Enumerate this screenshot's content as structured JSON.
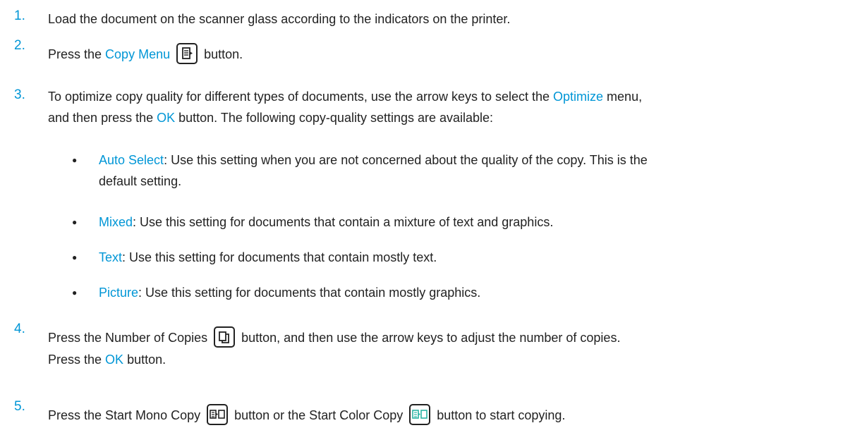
{
  "steps": [
    {
      "number": "1.",
      "text": "Load the document on the scanner glass according to the indicators on the printer."
    },
    {
      "number": "2.",
      "pre": "Press the ",
      "link": "Copy Menu",
      "post": " button.",
      "icon": "copy-menu-icon"
    },
    {
      "number": "3.",
      "pre": "To optimize copy quality for different types of documents, use the arrow keys to select the ",
      "link1": "Optimize",
      "mid1": " menu,",
      "line2_pre": "and then press the ",
      "link2": "OK",
      "line2_post": " button. The following copy-quality settings are available:",
      "options": [
        {
          "name": "Auto Select",
          "desc_line1": ": Use this setting when you are not concerned about the quality of the copy. This is the",
          "desc_line2": "default setting."
        },
        {
          "name": "Mixed",
          "desc_line1": ": Use this setting for documents that contain a mixture of text and graphics."
        },
        {
          "name": "Text",
          "desc_line1": ": Use this setting for documents that contain mostly text."
        },
        {
          "name": "Picture",
          "desc_line1": ": Use this setting for documents that contain mostly graphics."
        }
      ]
    },
    {
      "number": "4.",
      "pre": "Press the Number of Copies ",
      "post": " button, and then use the arrow keys to adjust the number of copies.",
      "line2_pre": "Press the ",
      "link": "OK",
      "line2_post": " button.",
      "icon": "number-of-copies-icon"
    },
    {
      "number": "5.",
      "pre": "Press the Start Mono Copy ",
      "mid": " button or the Start Color Copy ",
      "post": " button to start copying.",
      "icon1": "start-mono-copy-icon",
      "icon2": "start-color-copy-icon"
    }
  ],
  "bullet_glyph": "●",
  "colors": {
    "accent": "#0096d6",
    "text": "#222222",
    "color_copy_icon": "#2bb3a3"
  }
}
